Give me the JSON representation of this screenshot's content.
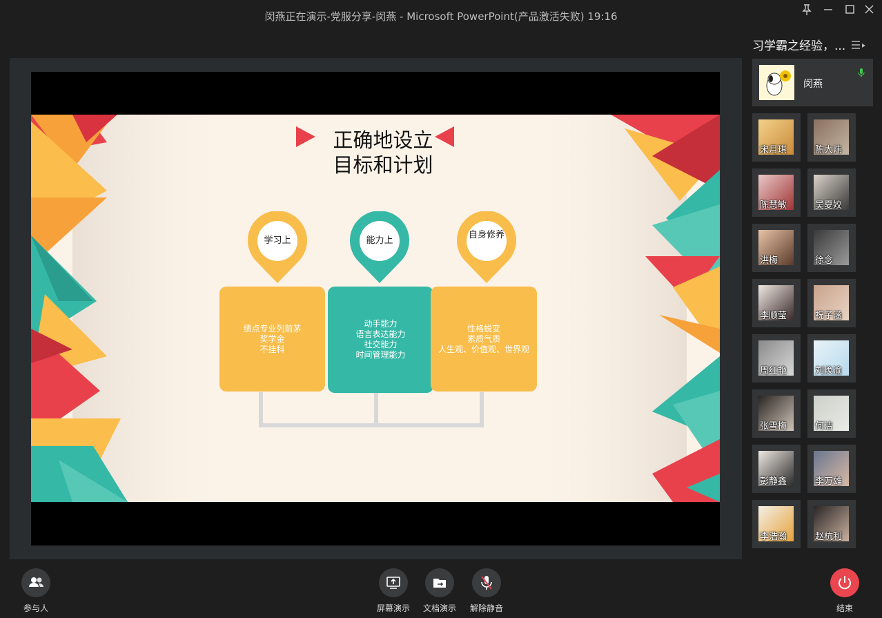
{
  "window": {
    "title": "闵燕正在演示-党服分享-闵燕 - Microsoft PowerPoint(产品激活失败) 19:16"
  },
  "slide": {
    "title_line1": "正确地设立",
    "title_line2": "目标和计划",
    "pins": [
      "学习上",
      "能力上",
      "自身修养"
    ],
    "boxes": [
      [
        "绩点专业列前茅",
        "奖学金",
        "不挂科"
      ],
      [
        "动手能力",
        "语言表达能力",
        "社交能力",
        "时间管理能力"
      ],
      [
        "性格蜕变",
        "素质气质",
        "人生观、价值观、世界观"
      ]
    ],
    "colors": {
      "yellow": "#f8bd4a",
      "teal": "#35b8a6",
      "red": "#e8414c",
      "orange": "#f7a13a"
    }
  },
  "sidebar": {
    "meeting_name": "习学霸之经验，...",
    "host": {
      "name": "闵燕"
    },
    "participants": [
      "宋月琪",
      "陈大炜",
      "陈慧敏",
      "吴夏姣",
      "洪梅",
      "徐念",
      "李顺莹",
      "祝子涵",
      "周红艳",
      "刘焕渝",
      "张雪梅",
      "何洁",
      "彭静鑫",
      "李万雄",
      "李浩瀚",
      "赵杭利"
    ]
  },
  "bottom": {
    "participants_label": "参与人",
    "screen_share_label": "屏幕演示",
    "doc_share_label": "文档演示",
    "unmute_label": "解除静音",
    "end_label": "结束"
  }
}
